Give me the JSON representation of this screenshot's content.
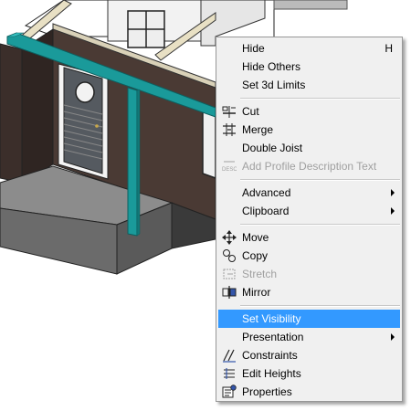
{
  "menu": {
    "items": [
      {
        "label": "Hide",
        "shortcut": "H"
      },
      {
        "label": "Hide Others"
      },
      {
        "label": "Set 3d Limits"
      },
      {
        "label": "Cut",
        "icon": "cut-wall-icon"
      },
      {
        "label": "Merge",
        "icon": "merge-icon"
      },
      {
        "label": "Double Joist"
      },
      {
        "label": "Add Profile Description Text",
        "icon": "desc-text-icon",
        "disabled": true
      },
      {
        "label": "Advanced",
        "submenu": true
      },
      {
        "label": "Clipboard",
        "submenu": true
      },
      {
        "label": "Move",
        "icon": "move-arrows-icon"
      },
      {
        "label": "Copy",
        "icon": "copy-icon"
      },
      {
        "label": "Stretch",
        "icon": "stretch-icon",
        "disabled": true
      },
      {
        "label": "Mirror",
        "icon": "mirror-icon"
      },
      {
        "label": "Set Visibility",
        "highlighted": true
      },
      {
        "label": "Presentation",
        "submenu": true
      },
      {
        "label": "Constraints",
        "icon": "constraints-icon"
      },
      {
        "label": "Edit Heights",
        "icon": "edit-heights-icon"
      },
      {
        "label": "Properties",
        "icon": "properties-icon"
      }
    ]
  },
  "colors": {
    "highlight": "#3399ff",
    "selected_beam": "#1a9a9a",
    "wall_dark": "#4a3a34",
    "floor_gray": "#8c8c8c"
  }
}
